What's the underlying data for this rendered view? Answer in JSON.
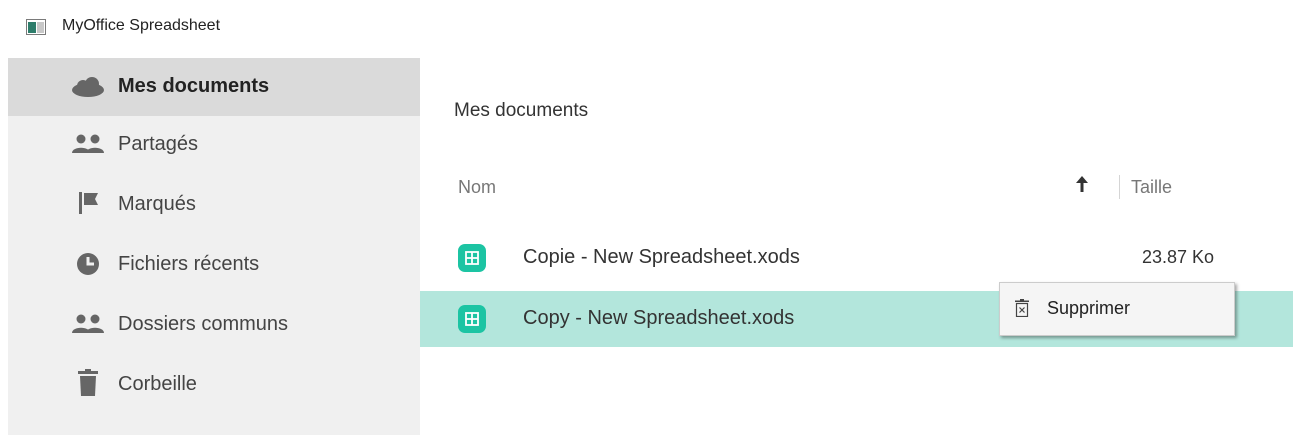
{
  "window": {
    "title": "MyOffice Spreadsheet",
    "icon": "app-window-icon"
  },
  "sidebar": {
    "items": [
      {
        "label": "Mes documents",
        "icon": "cloud-icon",
        "active": true
      },
      {
        "label": "Partagés",
        "icon": "people-icon"
      },
      {
        "label": "Marqués",
        "icon": "flag-icon"
      },
      {
        "label": "Fichiers récents",
        "icon": "clock-icon"
      },
      {
        "label": "Dossiers communs",
        "icon": "people-icon"
      },
      {
        "label": "Corbeille",
        "icon": "trash-icon"
      }
    ]
  },
  "main": {
    "title": "Mes documents",
    "columns": {
      "name": "Nom",
      "size": "Taille",
      "sort": "ascending"
    },
    "files": [
      {
        "name": "Copie - New Spreadsheet.xods",
        "size": "23.87 Ko",
        "icon": "spreadsheet-file-icon",
        "selected": false
      },
      {
        "name": "Copy - New Spreadsheet.xods",
        "size": "",
        "icon": "spreadsheet-file-icon",
        "selected": true
      }
    ]
  },
  "context_menu": {
    "items": [
      {
        "label": "Supprimer",
        "icon": "delete-icon"
      }
    ]
  },
  "colors": {
    "accent": "#1cc4a3",
    "selection": "#b3e6dc",
    "sidebar_bg": "#f0f0f0",
    "sidebar_active": "#dadada"
  }
}
